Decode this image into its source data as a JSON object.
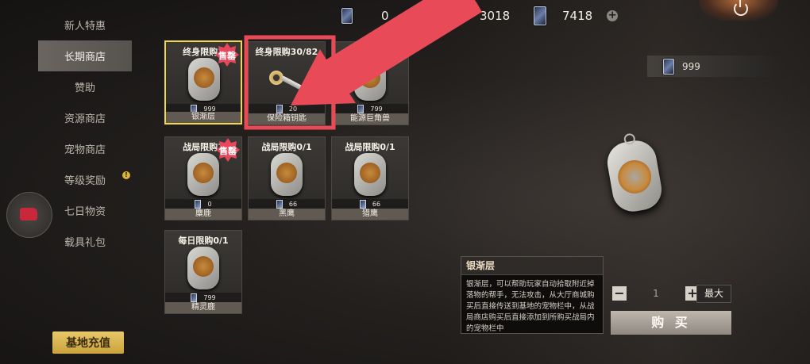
{
  "topbar": {
    "currency1": "0",
    "currency2": "3018",
    "currency3": "7418"
  },
  "sidebar": {
    "items": [
      {
        "label": "新人特惠"
      },
      {
        "label": "长期商店"
      },
      {
        "label": "赞助"
      },
      {
        "label": "资源商店"
      },
      {
        "label": "宠物商店"
      },
      {
        "label": "等级奖励"
      },
      {
        "label": "七日物资"
      },
      {
        "label": "载具礼包"
      }
    ],
    "badge": "!",
    "recharge_label": "基地充值"
  },
  "grid": {
    "items": [
      {
        "limit": "终身限购1",
        "price": "999",
        "name": "银渐层",
        "sold": "售罄"
      },
      {
        "limit": "终身限购30/82",
        "price": "20",
        "name": "保险箱钥匙"
      },
      {
        "limit": "限购",
        "price": "799",
        "name": "能源巨角兽"
      },
      {
        "limit": "战局限购1",
        "price": "0",
        "name": "麋鹿",
        "sold": "售罄"
      },
      {
        "limit": "战局限购0/1",
        "price": "66",
        "name": "黑鹰"
      },
      {
        "limit": "战局限购0/1",
        "price": "66",
        "name": "猎鹰"
      },
      {
        "limit": "每日限购0/1",
        "price": "799",
        "name": "精灵鹿"
      }
    ]
  },
  "detail": {
    "owned": "999",
    "title": "银渐层",
    "description": "银渐层，可以帮助玩家自动拾取附近掉落物的帮手，无法攻击，从大厅商城购买后直接传送到基地的宠物栏中，从战局商店购买后直接添加到所购买战局内的宠物栏中",
    "qty": "1",
    "minus": "−",
    "plus": "+",
    "max_label": "最大",
    "buy_label": "购 买"
  },
  "colors": {
    "selected_border": "#f0d84a",
    "sold_badge": "#e8465a",
    "annotation": "#e84a58"
  }
}
